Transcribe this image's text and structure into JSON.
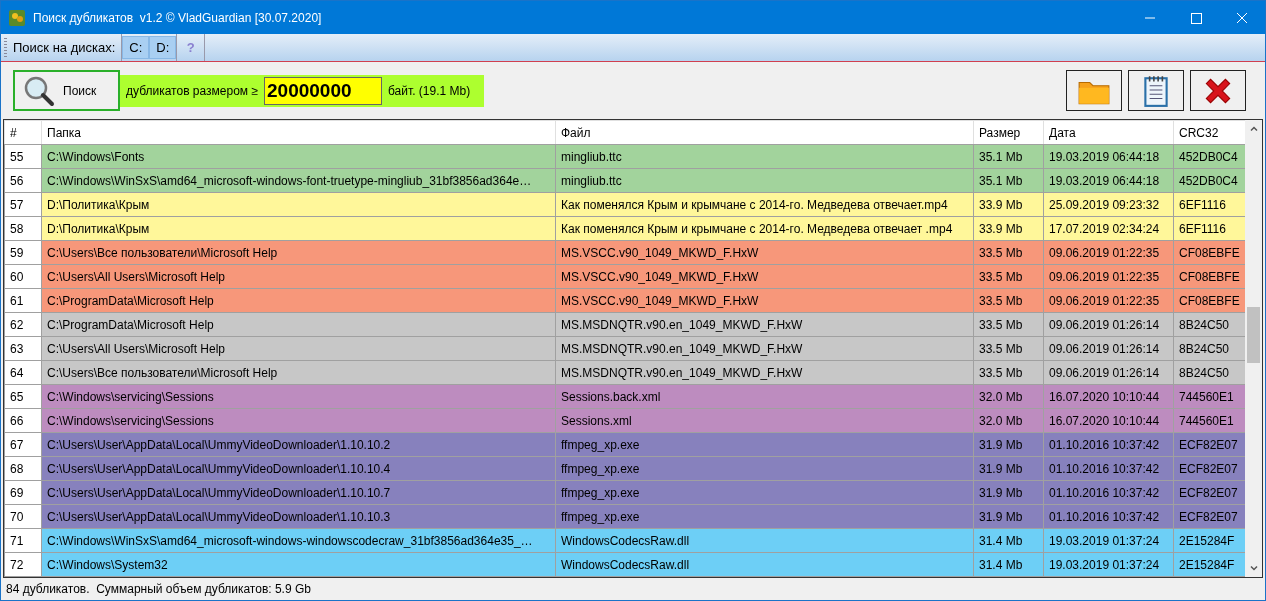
{
  "window": {
    "title": "Поиск дубликатов  v1.2 © VladGuardian [30.07.2020]"
  },
  "toolbar": {
    "label": "Поиск на дисках:",
    "drives": [
      {
        "label": "C:",
        "selected": true
      },
      {
        "label": "D:",
        "selected": true
      }
    ],
    "help": "?"
  },
  "search": {
    "button": "Поиск",
    "prefix": "дубликатов размером ≥",
    "value": "20000000",
    "suffix": "байт. (19.1 Mb)"
  },
  "table": {
    "columns": [
      "#",
      "Папка",
      "Файл",
      "Размер",
      "Дата",
      "CRC32"
    ],
    "rows": [
      {
        "cells": [
          "55",
          "C:\\Windows\\Fonts",
          "mingliub.ttc",
          "35.1 Mb",
          "19.03.2019 06:44:18",
          "452DB0C4"
        ],
        "color": "#a2d39c"
      },
      {
        "cells": [
          "56",
          "C:\\Windows\\WinSxS\\amd64_microsoft-windows-font-truetype-mingliub_31bf3856ad364e…",
          "mingliub.ttc",
          "35.1 Mb",
          "19.03.2019 06:44:18",
          "452DB0C4"
        ],
        "color": "#a2d39c"
      },
      {
        "cells": [
          "57",
          "D:\\Политика\\Крым",
          "Как поменялся Крым и крымчане с 2014-го. Медведева отвечает.mp4",
          "33.9 Mb",
          "25.09.2019 09:23:32",
          "6EF1116"
        ],
        "color": "#fff79a"
      },
      {
        "cells": [
          "58",
          "D:\\Политика\\Крым",
          "Как поменялся Крым и крымчане с 2014-го. Медведева отвечает .mp4",
          "33.9 Mb",
          "17.07.2019 02:34:24",
          "6EF1116"
        ],
        "color": "#fff79a"
      },
      {
        "cells": [
          "59",
          "C:\\Users\\Все пользователи\\Microsoft Help",
          "MS.VSCC.v90_1049_MKWD_F.HxW",
          "33.5 Mb",
          "09.06.2019 01:22:35",
          "CF08EBFE"
        ],
        "color": "#f7977a"
      },
      {
        "cells": [
          "60",
          "C:\\Users\\All Users\\Microsoft Help",
          "MS.VSCC.v90_1049_MKWD_F.HxW",
          "33.5 Mb",
          "09.06.2019 01:22:35",
          "CF08EBFE"
        ],
        "color": "#f7977a"
      },
      {
        "cells": [
          "61",
          "C:\\ProgramData\\Microsoft Help",
          "MS.VSCC.v90_1049_MKWD_F.HxW",
          "33.5 Mb",
          "09.06.2019 01:22:35",
          "CF08EBFE"
        ],
        "color": "#f7977a"
      },
      {
        "cells": [
          "62",
          "C:\\ProgramData\\Microsoft Help",
          "MS.MSDNQTR.v90.en_1049_MKWD_F.HxW",
          "33.5 Mb",
          "09.06.2019 01:26:14",
          "8B24C50"
        ],
        "color": "#c7c7c7"
      },
      {
        "cells": [
          "63",
          "C:\\Users\\All Users\\Microsoft Help",
          "MS.MSDNQTR.v90.en_1049_MKWD_F.HxW",
          "33.5 Mb",
          "09.06.2019 01:26:14",
          "8B24C50"
        ],
        "color": "#c7c7c7"
      },
      {
        "cells": [
          "64",
          "C:\\Users\\Все пользователи\\Microsoft Help",
          "MS.MSDNQTR.v90.en_1049_MKWD_F.HxW",
          "33.5 Mb",
          "09.06.2019 01:26:14",
          "8B24C50"
        ],
        "color": "#c7c7c7"
      },
      {
        "cells": [
          "65",
          "C:\\Windows\\servicing\\Sessions",
          "Sessions.back.xml",
          "32.0 Mb",
          "16.07.2020 10:10:44",
          "744560E1"
        ],
        "color": "#bd8cbf"
      },
      {
        "cells": [
          "66",
          "C:\\Windows\\servicing\\Sessions",
          "Sessions.xml",
          "32.0 Mb",
          "16.07.2020 10:10:44",
          "744560E1"
        ],
        "color": "#bd8cbf"
      },
      {
        "cells": [
          "67",
          "C:\\Users\\User\\AppData\\Local\\UmmyVideoDownloader\\1.10.10.2",
          "ffmpeg_xp.exe",
          "31.9 Mb",
          "01.10.2016 10:37:42",
          "ECF82E07"
        ],
        "color": "#8781bd"
      },
      {
        "cells": [
          "68",
          "C:\\Users\\User\\AppData\\Local\\UmmyVideoDownloader\\1.10.10.4",
          "ffmpeg_xp.exe",
          "31.9 Mb",
          "01.10.2016 10:37:42",
          "ECF82E07"
        ],
        "color": "#8781bd"
      },
      {
        "cells": [
          "69",
          "C:\\Users\\User\\AppData\\Local\\UmmyVideoDownloader\\1.10.10.7",
          "ffmpeg_xp.exe",
          "31.9 Mb",
          "01.10.2016 10:37:42",
          "ECF82E07"
        ],
        "color": "#8781bd"
      },
      {
        "cells": [
          "70",
          "C:\\Users\\User\\AppData\\Local\\UmmyVideoDownloader\\1.10.10.3",
          "ffmpeg_xp.exe",
          "31.9 Mb",
          "01.10.2016 10:37:42",
          "ECF82E07"
        ],
        "color": "#8781bd"
      },
      {
        "cells": [
          "71",
          "C:\\Windows\\WinSxS\\amd64_microsoft-windows-windowscodecraw_31bf3856ad364e35_…",
          "WindowsCodecsRaw.dll",
          "31.4 Mb",
          "19.03.2019 01:37:24",
          "2E15284F"
        ],
        "color": "#6dcff6"
      },
      {
        "cells": [
          "72",
          "C:\\Windows\\System32",
          "WindowsCodecsRaw.dll",
          "31.4 Mb",
          "19.03.2019 01:37:24",
          "2E15284F"
        ],
        "color": "#6dcff6"
      }
    ]
  },
  "status_bar": "84 дубликатов.  Суммарный объем дубликатов: 5.9 Gb"
}
